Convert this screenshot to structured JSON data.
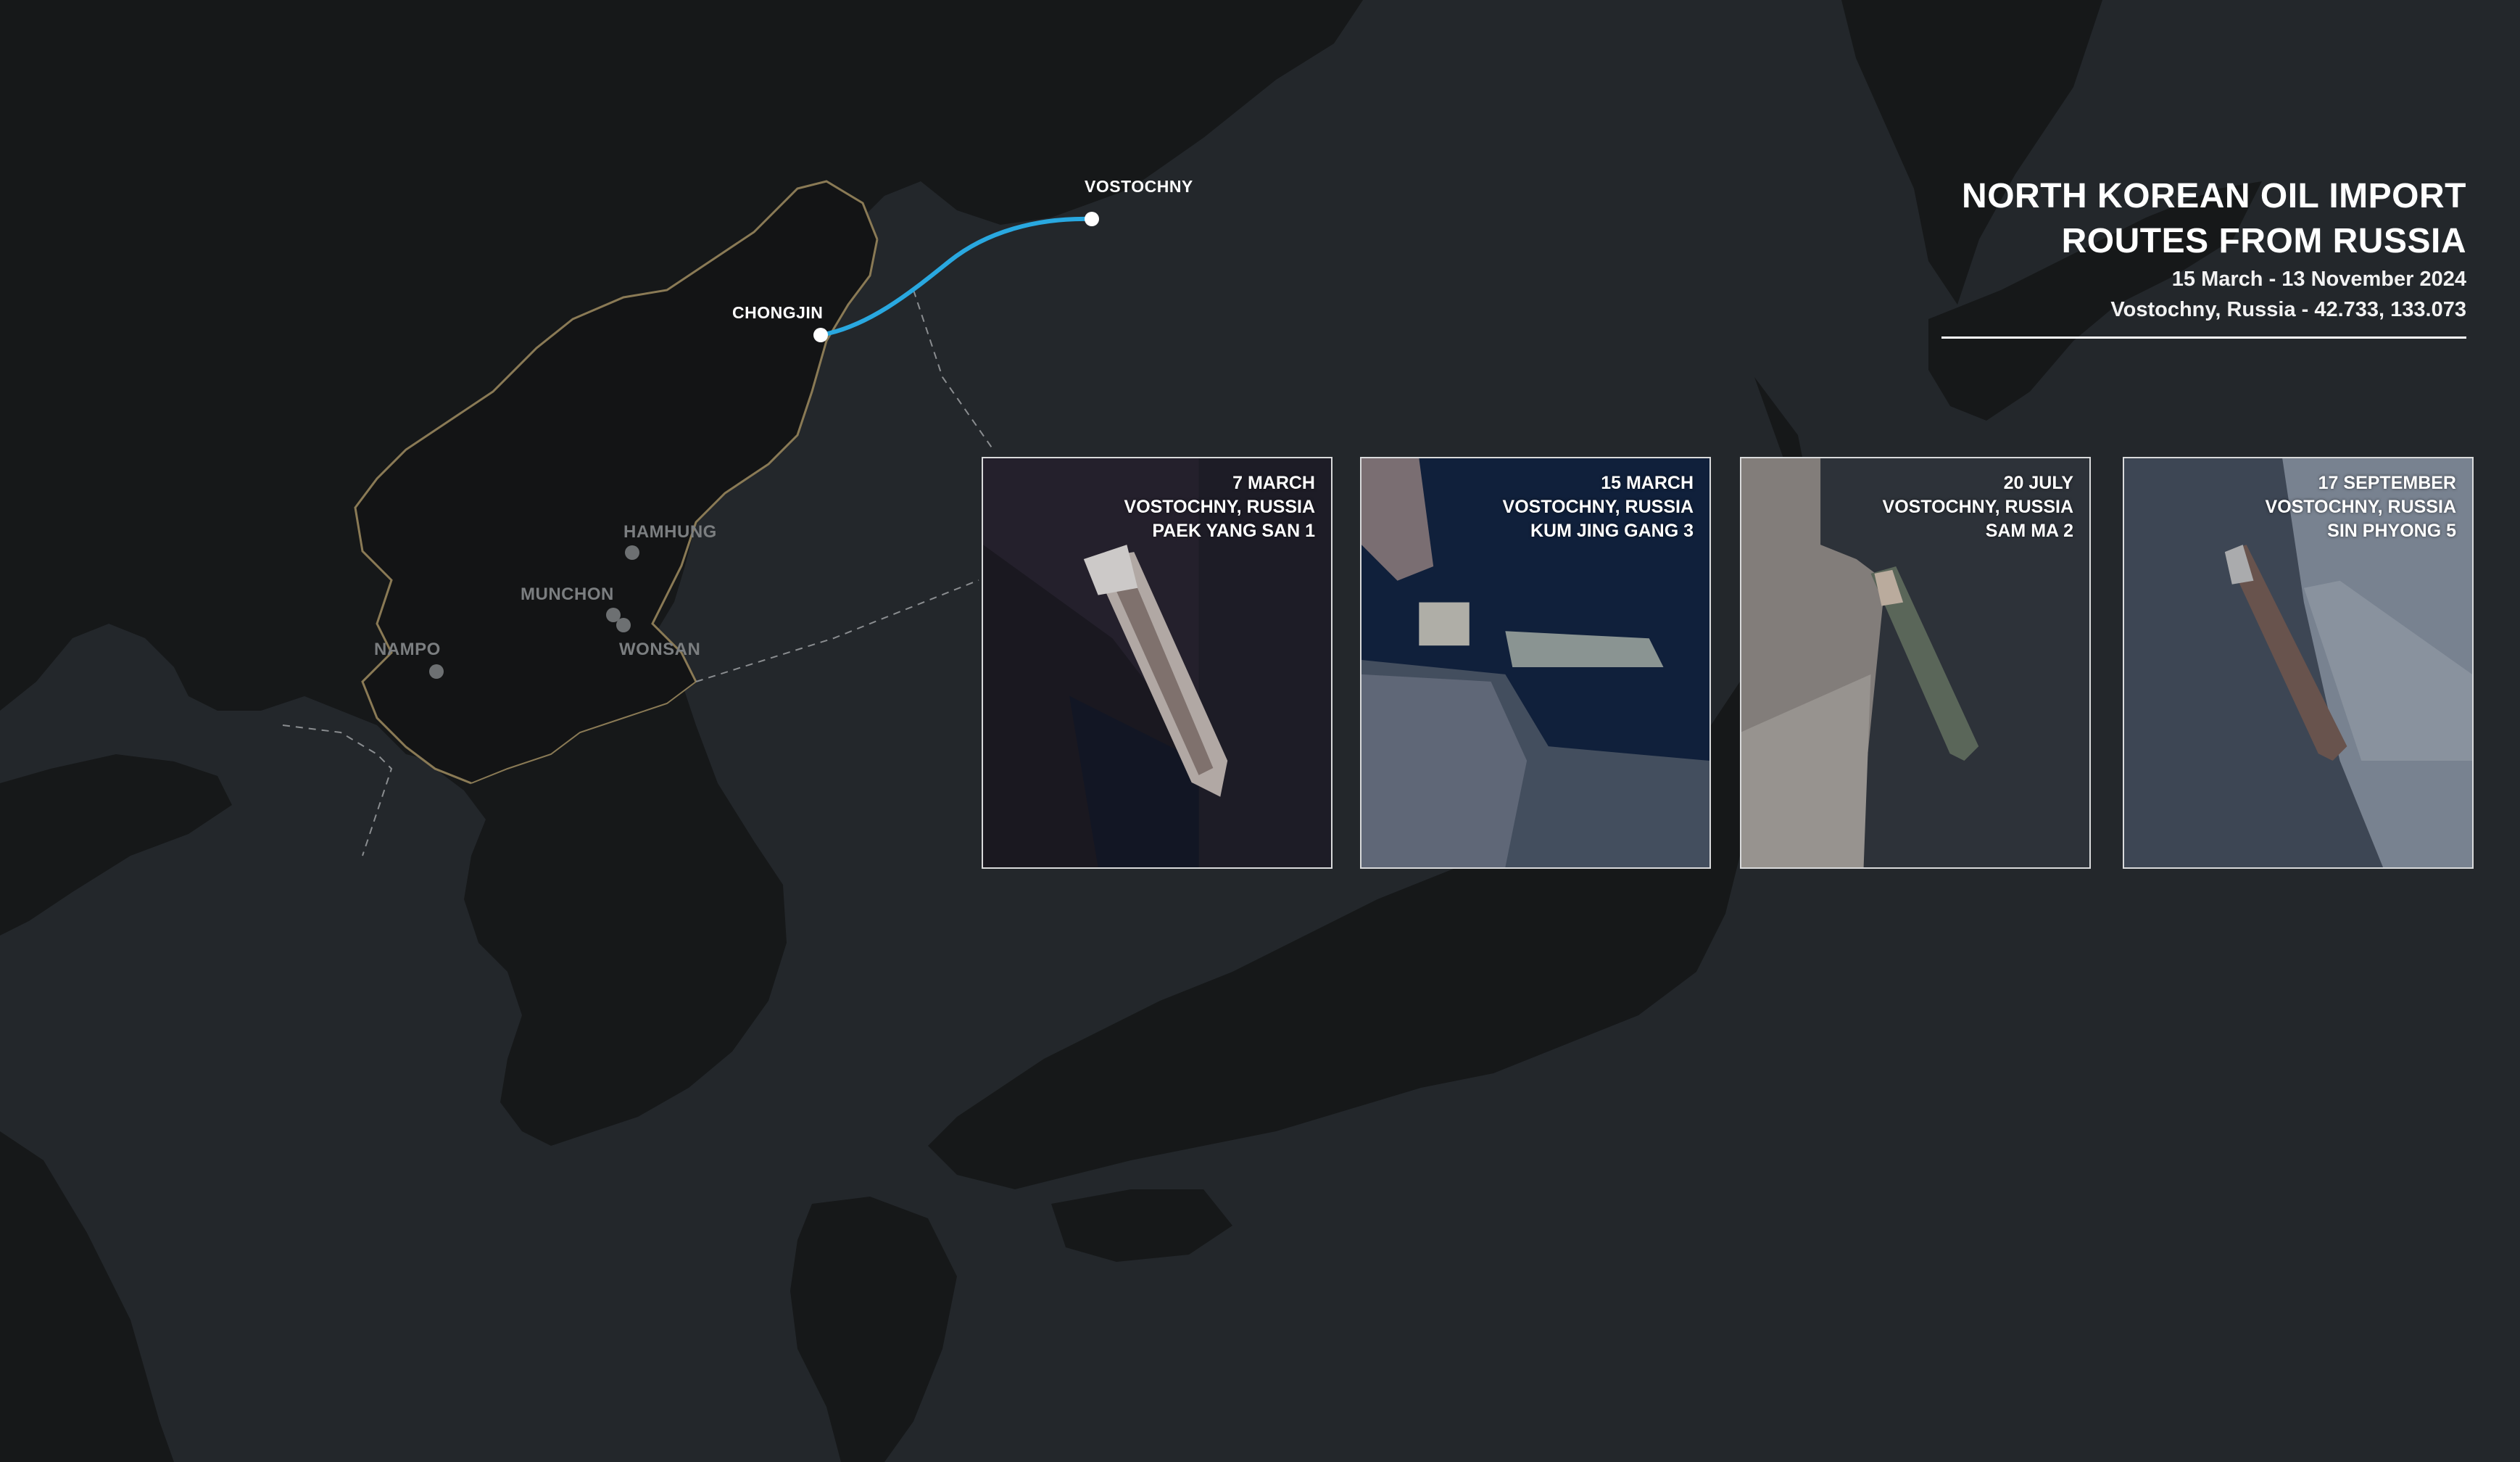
{
  "title": {
    "line1": "NORTH KOREAN OIL IMPORT",
    "line2": "ROUTES FROM RUSSIA",
    "date_range": "15 March - 13 November 2024",
    "location": "Vostochny, Russia - 42.733, 133.073"
  },
  "places": {
    "vostochny": "VOSTOCHNY",
    "chongjin": "CHONGJIN",
    "hamhung": "HAMHUNG",
    "munchon": "MUNCHON",
    "wonsan": "WONSAN",
    "nampo": "NAMPO"
  },
  "route": {
    "from": "CHONGJIN",
    "to": "VOSTOCHNY",
    "color": "#29a8e0"
  },
  "colors": {
    "sea": "#23272b",
    "land": "#161819",
    "north_korea_border": "#8a7a55",
    "route": "#29a8e0",
    "text": "#ffffff"
  },
  "cards": [
    {
      "date": "7 MARCH",
      "location": "VOSTOCHNY, RUSSIA",
      "vessel": "PAEK YANG SAN 1"
    },
    {
      "date": "15 MARCH",
      "location": "VOSTOCHNY, RUSSIA",
      "vessel": "KUM JING GANG 3"
    },
    {
      "date": "20 JULY",
      "location": "VOSTOCHNY, RUSSIA",
      "vessel": "SAM MA 2"
    },
    {
      "date": "17 SEPTEMBER",
      "location": "VOSTOCHNY, RUSSIA",
      "vessel": "SIN PHYONG 5"
    }
  ]
}
